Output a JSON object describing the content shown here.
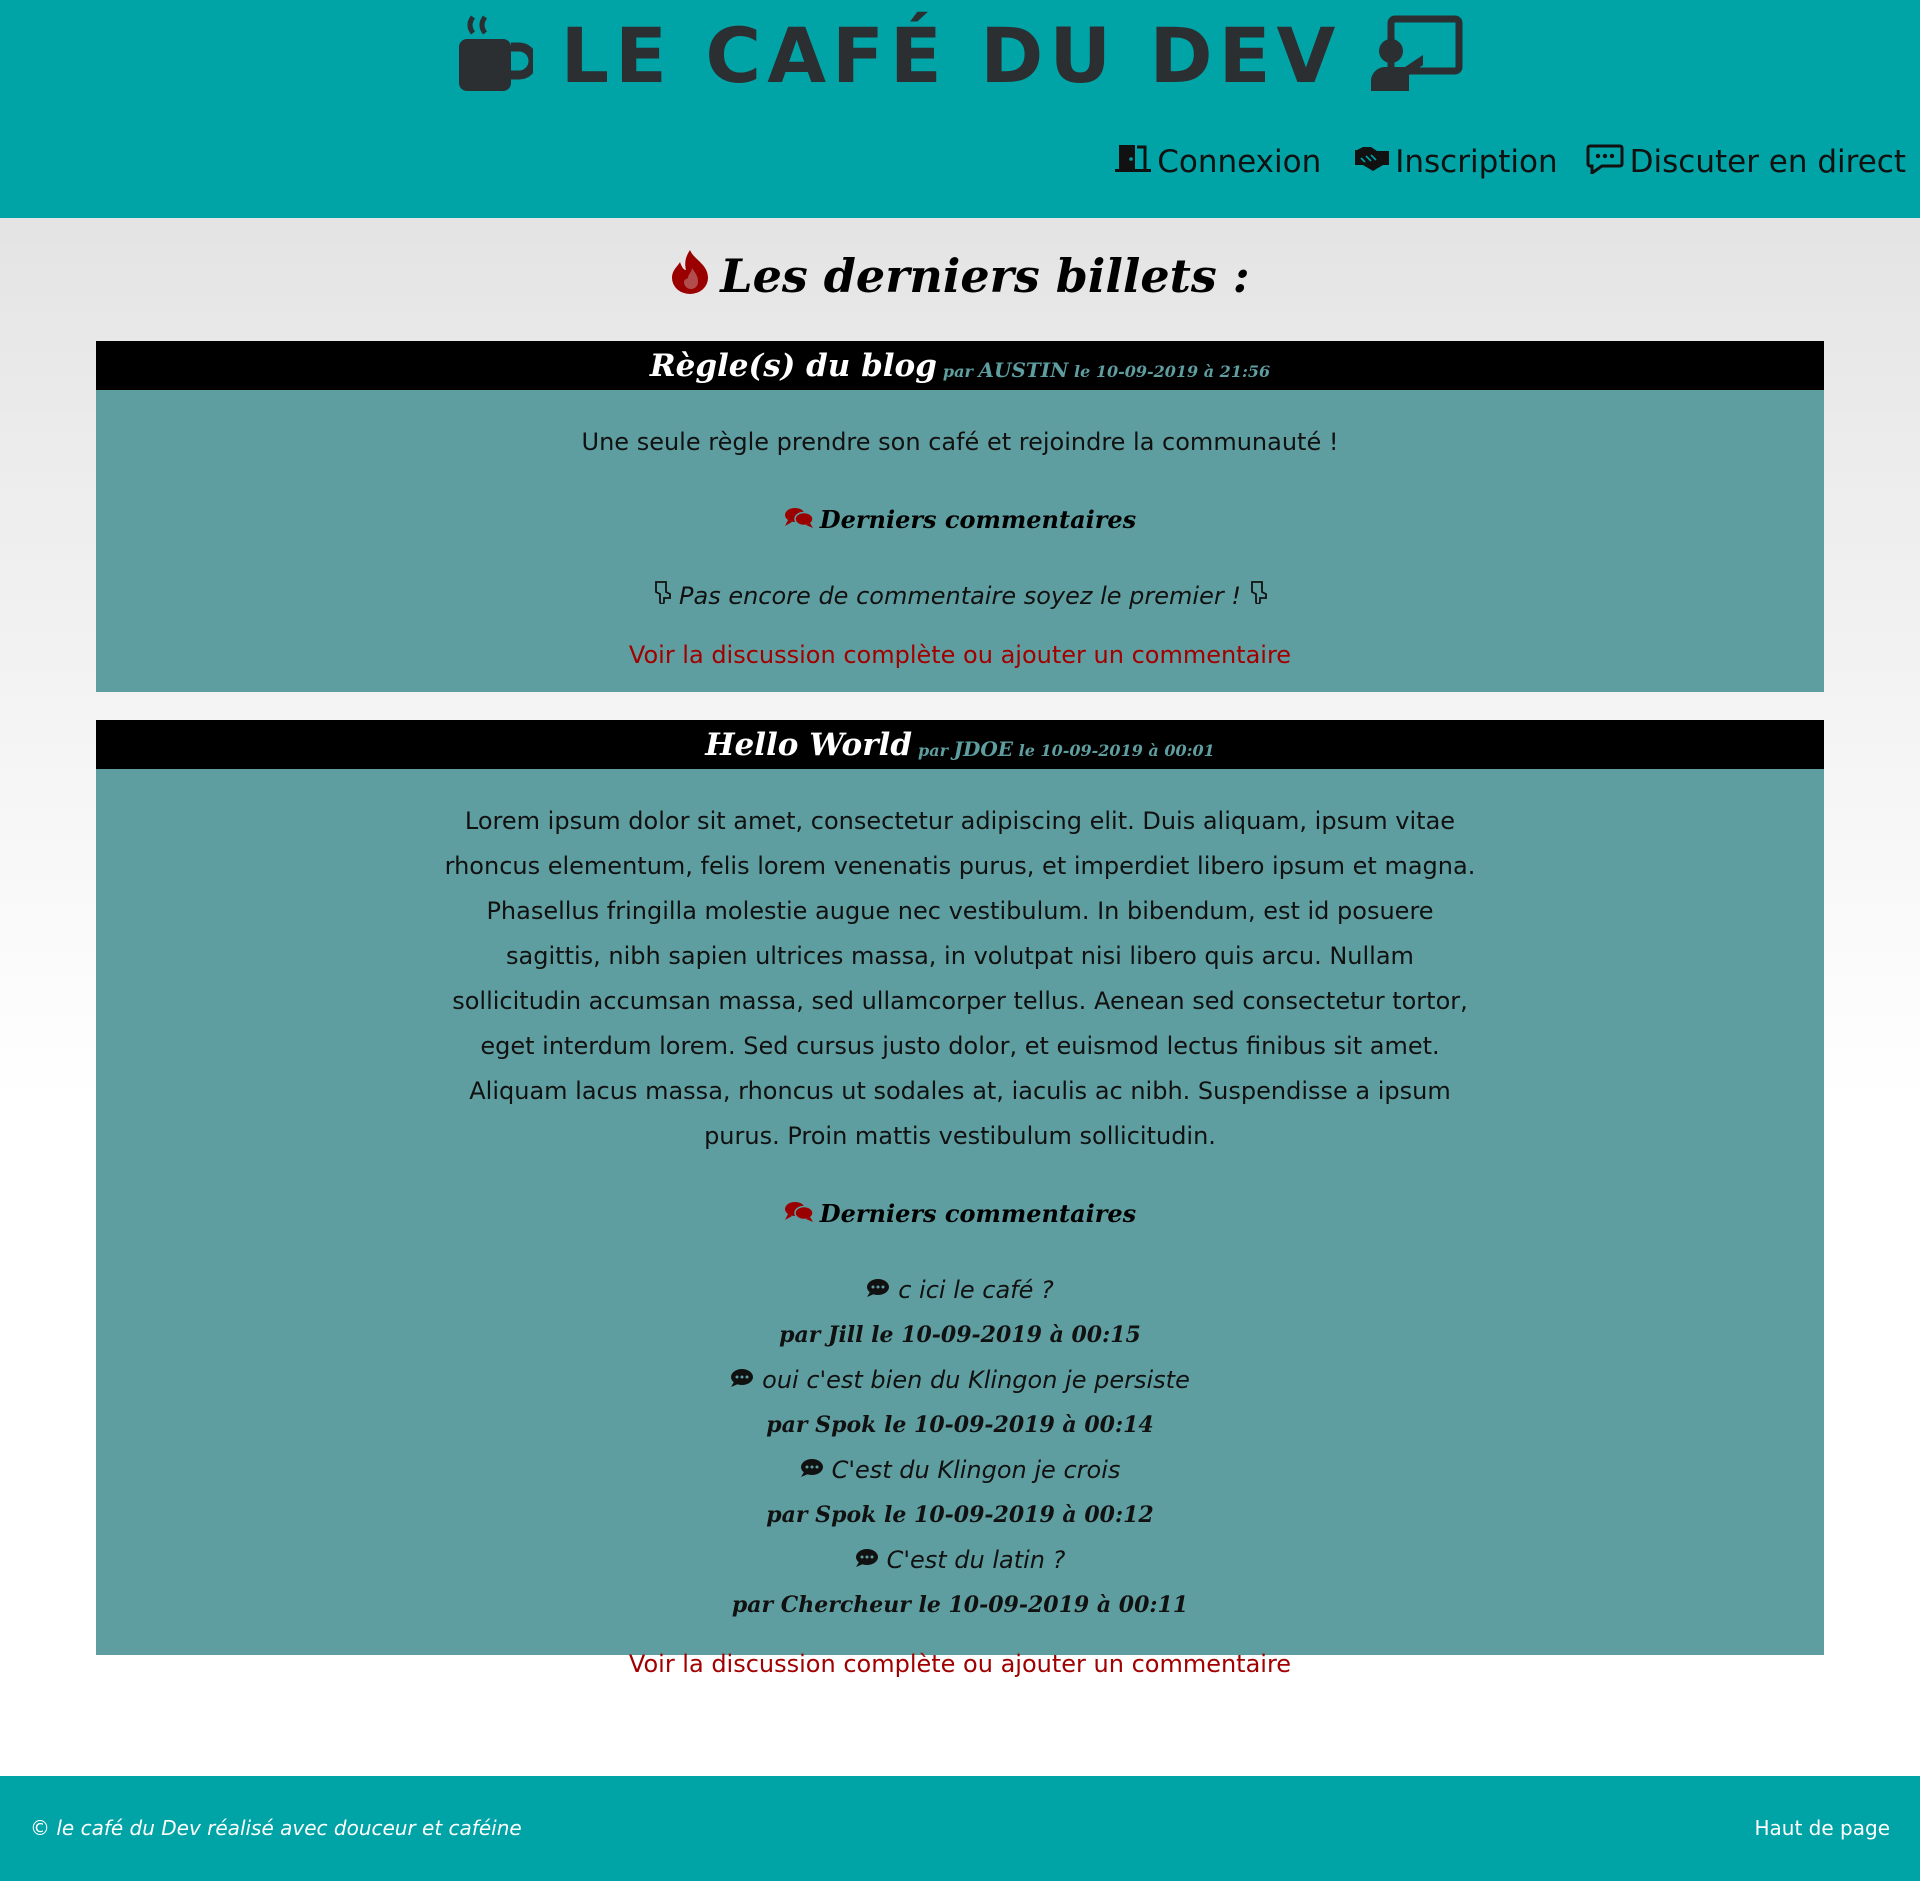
{
  "header": {
    "brand": "LE CAFÉ DU DEV",
    "nav": [
      {
        "label": "Connexion",
        "icon": "door-icon"
      },
      {
        "label": "Inscription",
        "icon": "handshake-icon"
      },
      {
        "label": "Discuter en direct",
        "icon": "chat-icon"
      }
    ]
  },
  "main": {
    "section_title": "Les derniers billets :",
    "posts": [
      {
        "title": "Règle(s) du blog",
        "by": "par",
        "author": "AUSTIN",
        "le": "le",
        "date": "10-09-2019 à 21:56",
        "content": "Une seule règle prendre son café et rejoindre la communauté !",
        "comments_title": "Derniers commentaires",
        "empty": "Pas encore de commentaire soyez le premier !",
        "more": "Voir la discussion complète ou ajouter un commentaire"
      },
      {
        "title": "Hello World",
        "by": "par",
        "author": "JDOE",
        "le": "le",
        "date": "10-09-2019 à 00:01",
        "content": "Lorem ipsum dolor sit amet, consectetur adipiscing elit. Duis aliquam, ipsum vitae rhoncus elementum, felis lorem venenatis purus, et imperdiet libero ipsum et magna. Phasellus fringilla molestie augue nec vestibulum. In bibendum, est id posuere sagittis, nibh sapien ultrices massa, in volutpat nisi libero quis arcu. Nullam sollicitudin accumsan massa, sed ullamcorper tellus. Aenean sed consectetur tortor, eget interdum lorem. Sed cursus justo dolor, et euismod lectus finibus sit amet. Aliquam lacus massa, rhoncus ut sodales at, iaculis ac nibh. Suspendisse a ipsum purus. Proin mattis vestibulum sollicitudin.",
        "comments_title": "Derniers commentaires",
        "comments": [
          {
            "text": "c ici le café ?",
            "meta": "par Jill le 10-09-2019 à 00:15"
          },
          {
            "text": "oui c'est bien du Klingon je persiste",
            "meta": "par Spok le 10-09-2019 à 00:14"
          },
          {
            "text": "C'est du Klingon je crois",
            "meta": "par Spok le 10-09-2019 à 00:12"
          },
          {
            "text": "C'est du latin ?",
            "meta": "par Chercheur le 10-09-2019 à 00:11"
          }
        ],
        "more": "Voir la discussion complète ou ajouter un commentaire"
      }
    ]
  },
  "footer": {
    "copyright": "© le café du Dev réalisé avec douceur et caféine",
    "top_link": "Haut de page"
  },
  "colors": {
    "header_bg": "#00a3a6",
    "post_bg": "#5f9ea0",
    "link_red": "#a10000",
    "flame": "#9a0000"
  }
}
